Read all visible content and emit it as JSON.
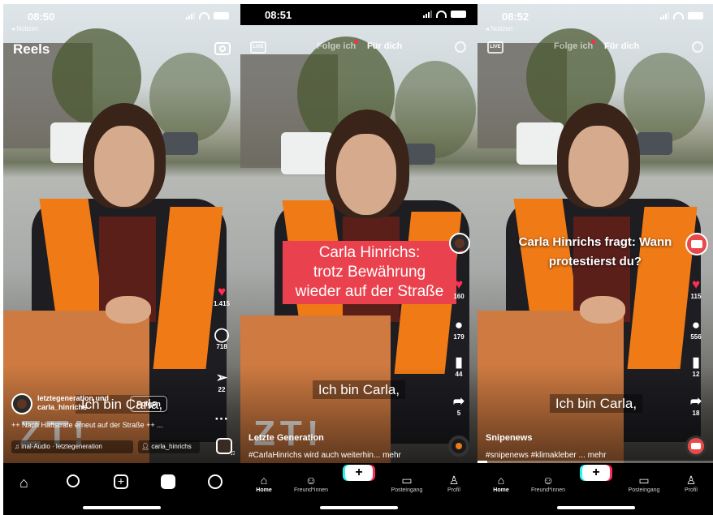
{
  "p1": {
    "time": "08:50",
    "back": "◂ Notizen",
    "header_title": "Reels",
    "subtitle": "Ich bin Carla,",
    "likes": "1.415",
    "comments": "718",
    "shares": "22",
    "more": "···",
    "account": "letztegeneration und carla_hinrichs",
    "follow": "Folgen",
    "caption": "++ Nach Haftstrafe erneut auf der Straße ++ ...",
    "audio": "♫  inal-Audio · letztegeneration",
    "tagged": "carla_hinrichs"
  },
  "p2": {
    "time": "08:51",
    "tab_following": "Folge ich",
    "tab_foryou": "Für dich",
    "red_label": [
      "Carla Hinrichs:",
      "trotz Bewährung",
      "wieder auf der Straße"
    ],
    "likes": "160",
    "comments": "179",
    "bookmarks": "44",
    "shares": "5",
    "subtitle": "Ich bin Carla,",
    "account": "Letzte Generation",
    "caption": "#CarlaHinrichs wird auch weiterhin... mehr",
    "tabs": [
      "Home",
      "Freund*innen",
      "",
      "Posteingang",
      "Profil"
    ]
  },
  "p3": {
    "time": "08:52",
    "back": "◂ Notizen",
    "tab_following": "Folge ich",
    "tab_foryou": "Für dich",
    "overlay": "Carla Hinrichs fragt: Wann protestierst du?",
    "likes": "115",
    "comments": "556",
    "bookmarks": "12",
    "shares": "18",
    "subtitle": "Ich bin Carla,",
    "account": "Snipenews",
    "caption": "#snipenews #klimakleber ... mehr",
    "tabs": [
      "Home",
      "Freund*innen",
      "",
      "Posteingang",
      "Profil"
    ]
  }
}
